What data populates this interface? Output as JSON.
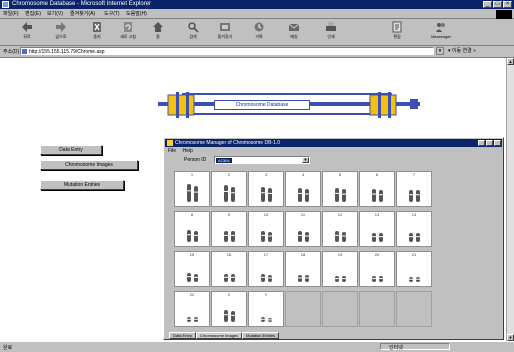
{
  "window": {
    "title": "Chromosome Database - Microsoft Internet Explorer",
    "buttons": [
      "_",
      "□",
      "×"
    ]
  },
  "menubar": {
    "items": [
      "파일(F)",
      "편집(E)",
      "보기(V)",
      "즐겨찾기(A)",
      "도구(T)",
      "도움말(H)"
    ]
  },
  "toolbar": {
    "buttons": [
      {
        "label": "뒤로",
        "icon": "back-arrow-icon"
      },
      {
        "label": "앞으로",
        "icon": "forward-arrow-icon"
      },
      {
        "label": "중지",
        "icon": "stop-icon"
      },
      {
        "label": "새로 고침",
        "icon": "refresh-icon"
      },
      {
        "label": "홈",
        "icon": "home-icon"
      },
      {
        "label": "검색",
        "icon": "search-icon"
      },
      {
        "label": "즐겨찾기",
        "icon": "favorites-icon"
      },
      {
        "label": "기록",
        "icon": "history-icon"
      },
      {
        "label": "메일",
        "icon": "mail-icon"
      },
      {
        "label": "인쇄",
        "icon": "print-icon"
      },
      {
        "label": "편집",
        "icon": "edit-icon"
      },
      {
        "label": "Messenger",
        "icon": "messenger-icon"
      }
    ]
  },
  "addressbar": {
    "label": "주소(D)",
    "url": "http://155.155.115.79/Chrome.asp",
    "links": "▾ 이동  연결 »"
  },
  "banner": {
    "title": "Chromosome Database"
  },
  "nav": {
    "buttons": [
      "Data Entry",
      "Chromosome Images",
      "Mutation Entries"
    ]
  },
  "dialog": {
    "title": "Chromosome Manager of Chromosome DB-1.0",
    "menu": [
      "File",
      "Help"
    ],
    "person_label": "Person ID",
    "person_value": "A2304",
    "chromosomes": [
      "1",
      "2",
      "3",
      "4",
      "5",
      "6",
      "7",
      "8",
      "9",
      "10",
      "11",
      "12",
      "13",
      "14",
      "15",
      "16",
      "17",
      "18",
      "19",
      "20",
      "21",
      "22",
      "X",
      "Y"
    ],
    "tabs": [
      "Data Entry",
      "Chromosome Images",
      "Mutation Entries"
    ]
  },
  "status": {
    "left": "완료",
    "zone": "인터넷"
  },
  "colors": {
    "titlebar": "#0a246a",
    "banner_yellow": "#f4c20d",
    "banner_blue": "#3a4fb0"
  }
}
